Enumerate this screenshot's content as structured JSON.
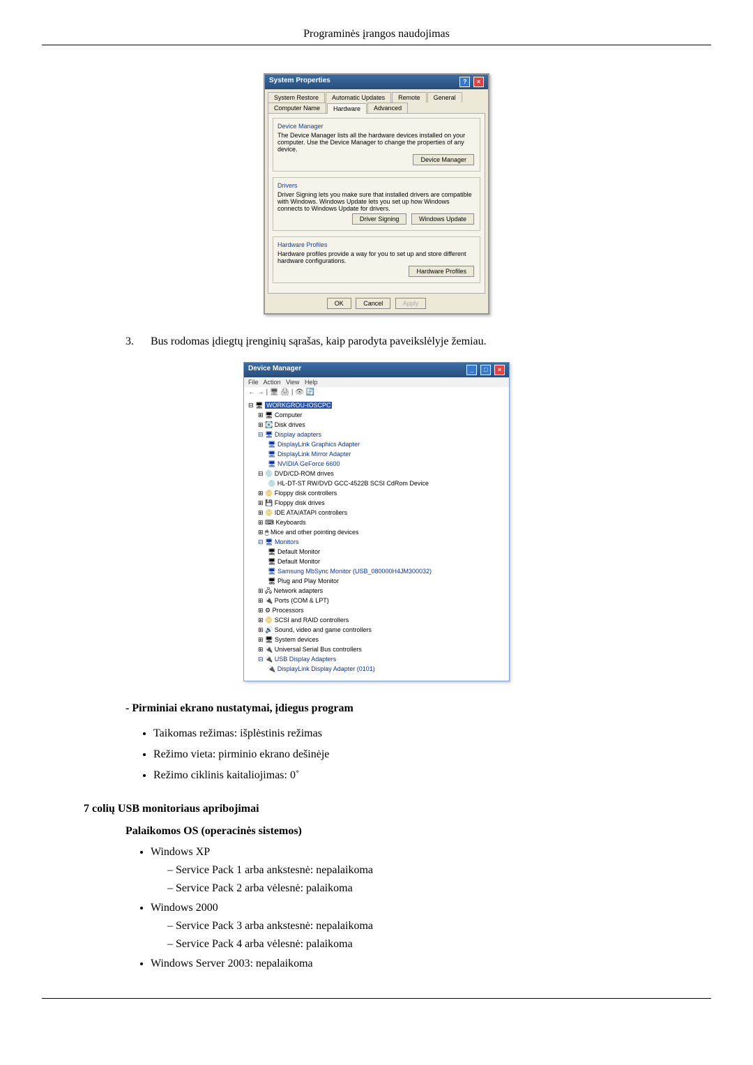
{
  "header": {
    "title": "Programinės įrangos naudojimas"
  },
  "fig1": {
    "title": "System Properties",
    "tabs": [
      "System Restore",
      "Automatic Updates",
      "Remote",
      "General",
      "Computer Name",
      "Hardware",
      "Advanced"
    ],
    "active_tab": "Hardware",
    "dm_title": "Device Manager",
    "dm_text": "The Device Manager lists all the hardware devices installed on your computer. Use the Device Manager to change the properties of any device.",
    "dm_btn": "Device Manager",
    "drv_title": "Drivers",
    "drv_text": "Driver Signing lets you make sure that installed drivers are compatible with Windows. Windows Update lets you set up how Windows connects to Windows Update for drivers.",
    "drv_btn1": "Driver Signing",
    "drv_btn2": "Windows Update",
    "hp_title": "Hardware Profiles",
    "hp_text": "Hardware profiles provide a way for you to set up and store different hardware configurations.",
    "hp_btn": "Hardware Profiles",
    "ok": "OK",
    "cancel": "Cancel",
    "apply": "Apply"
  },
  "step3": {
    "num": "3.",
    "text": "Bus rodomas įdiegtų įrenginių sąrašas, kaip parodyta paveikslėlyje žemiau."
  },
  "fig2": {
    "title": "Device Manager",
    "menu": [
      "File",
      "Action",
      "View",
      "Help"
    ],
    "root": "WORKGROU-IOSCPC",
    "nodes": {
      "computer": "Computer",
      "disk": "Disk drives",
      "display": "Display adapters",
      "display_c1": "DisplayLink Graphics Adapter",
      "display_c2": "DisplayLink Mirror Adapter",
      "display_c3": "NVIDIA GeForce 6600",
      "dvd": "DVD/CD-ROM drives",
      "dvd_c1": "HL-DT-ST RW/DVD GCC-4522B SCSI CdRom Device",
      "floppy1": "Floppy disk controllers",
      "floppy2": "Floppy disk drives",
      "ide": "IDE ATA/ATAPI controllers",
      "keyb": "Keyboards",
      "mice": "Mice and other pointing devices",
      "mon": "Monitors",
      "mon_c1": "Default Monitor",
      "mon_c2": "Default Monitor",
      "mon_c3": "Samsung MbSync Monitor (USB_080000H4JM300032)",
      "mon_c4": "Plug and Play Monitor",
      "net": "Network adapters",
      "ports": "Ports (COM & LPT)",
      "proc": "Processors",
      "scsi": "SCSI and RAID controllers",
      "sound": "Sound, video and game controllers",
      "sysdev": "System devices",
      "usbctrl": "Universal Serial Bus controllers",
      "usbdisp": "USB Display Adapters",
      "usbdisp_c1": "DisplayLink Display Adapter (0101)"
    }
  },
  "sect1_title": "- Pirminiai ekrano nustatymai, įdiegus program",
  "sect1_items": [
    "Taikomas režimas: išplėstinis režimas",
    "Režimo vieta: pirminio ekrano dešinėje",
    "Režimo ciklinis kaitaliojimas: 0˚"
  ],
  "h_limits": "7 colių USB monitoriaus apribojimai",
  "h_os": "Palaikomos OS (operacinės sistemos)",
  "os": {
    "xp": "Windows XP",
    "xp_sp1": "– Service Pack 1 arba ankstesnė: nepalaikoma",
    "xp_sp2": "– Service Pack 2 arba vėlesnė: palaikoma",
    "w2k": "Windows 2000",
    "w2k_sp3": "– Service Pack 3 arba ankstesnė: nepalaikoma",
    "w2k_sp4": "– Service Pack 4 arba vėlesnė: palaikoma",
    "ws2003": "Windows Server 2003: nepalaikoma"
  }
}
